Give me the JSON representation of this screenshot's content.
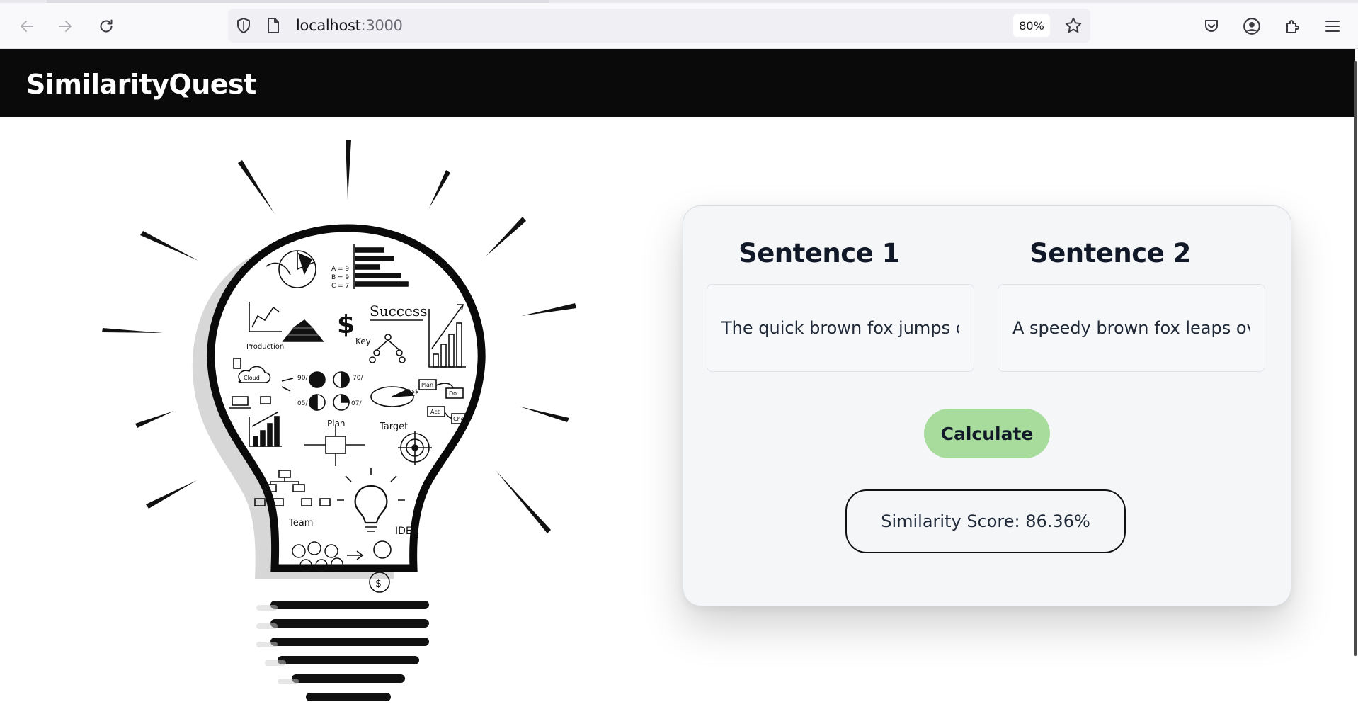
{
  "browser": {
    "url_host": "localhost",
    "url_port": ":3000",
    "zoom": "80%"
  },
  "app": {
    "title": "SimilarityQuest"
  },
  "illustration": {
    "labels": {
      "success": "Success",
      "key": "Key",
      "production": "Production",
      "plan": "Plan",
      "target": "Target",
      "team": "Team",
      "idea": "IDEA",
      "dollar": "$",
      "cloud": "Cloud",
      "abc": [
        "A = 9",
        "B = 9",
        "C = 7"
      ],
      "pct": [
        "90/",
        "70/",
        "05/",
        "07/"
      ],
      "plan_boxes": [
        "Plan",
        "Do",
        "Act",
        "Check"
      ],
      "money": "$$$"
    }
  },
  "form": {
    "sentence1_label": "Sentence 1",
    "sentence2_label": "Sentence 2",
    "sentence1_value": "The quick brown fox jumps over the lazy dog",
    "sentence2_value": "A speedy brown fox leaps over a lazy dog",
    "calculate_label": "Calculate",
    "score_text": "Similarity Score: 86.36%"
  },
  "colors": {
    "header_bg": "#0a0a0a",
    "button_bg": "#a7dc9c",
    "card_bg": "#f5f6f8"
  }
}
